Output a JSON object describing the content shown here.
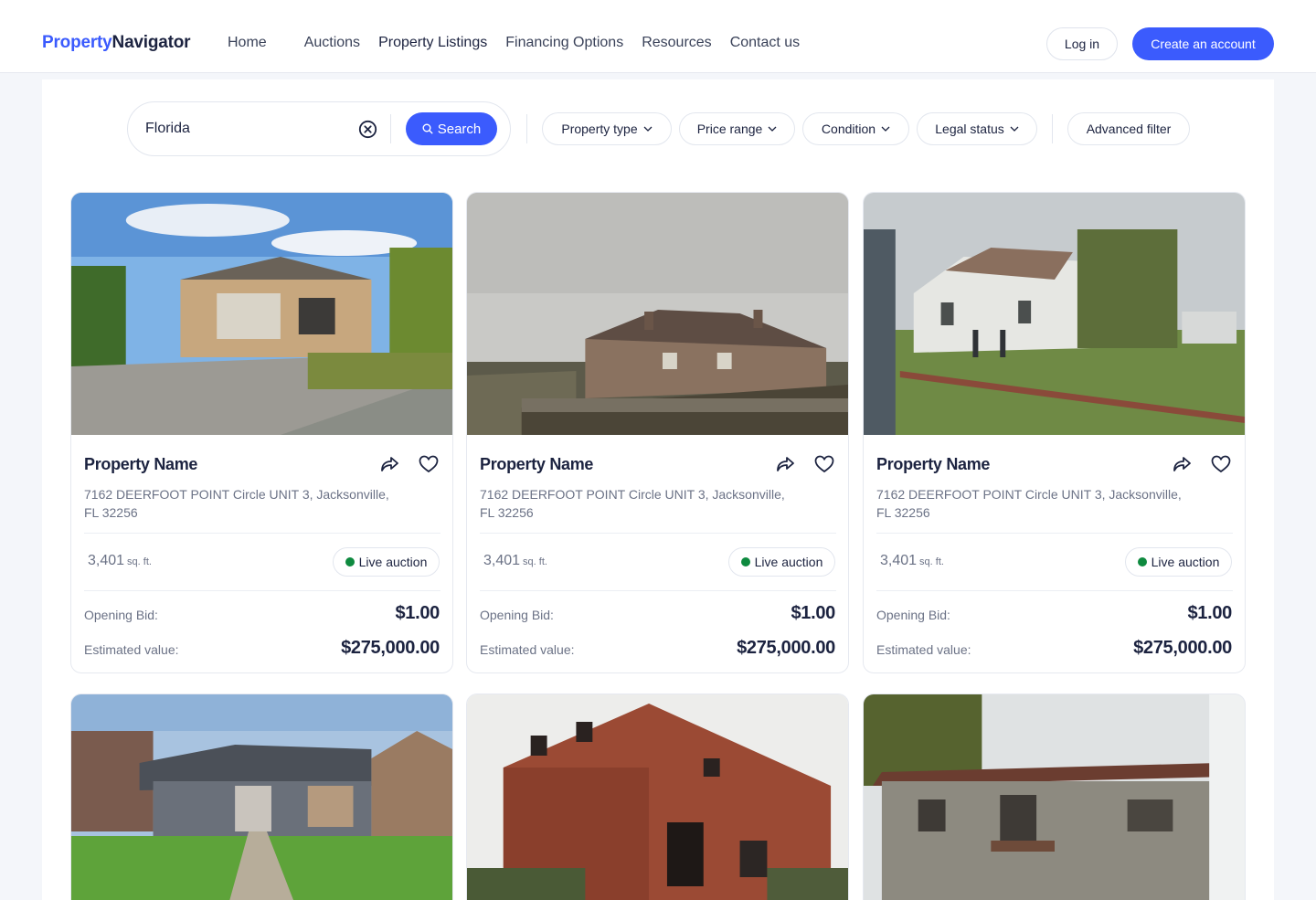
{
  "brand": {
    "part1": "Property",
    "part2": "Navigator"
  },
  "nav": [
    "Home",
    "Auctions",
    "Property Listings",
    "Financing Options",
    "Resources",
    "Contact us"
  ],
  "header": {
    "login": "Log in",
    "create": "Create an account"
  },
  "search": {
    "value": "Florida",
    "button": "Search"
  },
  "filters": [
    "Property type",
    "Price range",
    "Condition",
    "Legal status"
  ],
  "advanced": "Advanced filter",
  "cards": [
    {
      "name": "Property Name",
      "address": "7162 DEERFOOT POINT Circle UNIT 3, Jacksonville, FL 32256",
      "size": "3,401",
      "unit": "sq. ft.",
      "status": "Live auction",
      "bid_label": "Opening Bid:",
      "bid": "$1.00",
      "est_label": "Estimated value:",
      "est": "$275,000.00"
    },
    {
      "name": "Property Name",
      "address": "7162 DEERFOOT POINT Circle UNIT 3, Jacksonville, FL 32256",
      "size": "3,401",
      "unit": "sq. ft.",
      "status": "Live auction",
      "bid_label": "Opening Bid:",
      "bid": "$1.00",
      "est_label": "Estimated value:",
      "est": "$275,000.00"
    },
    {
      "name": "Property Name",
      "address": "7162 DEERFOOT POINT Circle UNIT 3, Jacksonville, FL 32256",
      "size": "3,401",
      "unit": "sq. ft.",
      "status": "Live auction",
      "bid_label": "Opening Bid:",
      "bid": "$1.00",
      "est_label": "Estimated value:",
      "est": "$275,000.00"
    }
  ],
  "colors": {
    "accent": "#3b5bfd",
    "live": "#0e8a3f",
    "text": "#1c2340"
  }
}
